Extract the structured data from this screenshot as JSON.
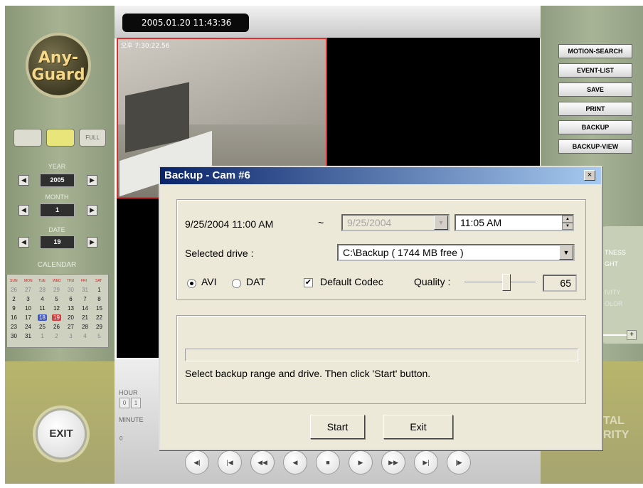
{
  "datetime": "2005.01.20  11:43:36",
  "cam1_osd": "오후 7:30:22.56",
  "logo": {
    "line1": "Any-",
    "line2": "Guard"
  },
  "view_buttons": {
    "full": "FULL"
  },
  "year": {
    "label": "YEAR",
    "value": "2005"
  },
  "month": {
    "label": "MONTH",
    "value": "1"
  },
  "date": {
    "label": "DATE",
    "value": "19"
  },
  "calendar": {
    "title": "CALENDAR",
    "days_of_week": [
      "SUN",
      "MON",
      "TUE",
      "WED",
      "THU",
      "FRI",
      "SAT"
    ],
    "weeks": [
      [
        "26",
        "27",
        "28",
        "29",
        "30",
        "31",
        "1"
      ],
      [
        "2",
        "3",
        "4",
        "5",
        "6",
        "7",
        "8"
      ],
      [
        "9",
        "10",
        "11",
        "12",
        "13",
        "14",
        "15"
      ],
      [
        "16",
        "17",
        "18",
        "19",
        "20",
        "21",
        "22"
      ],
      [
        "23",
        "24",
        "25",
        "26",
        "27",
        "28",
        "29"
      ],
      [
        "30",
        "31",
        "1",
        "2",
        "3",
        "4",
        "5"
      ]
    ]
  },
  "exit_label": "EXIT",
  "right_buttons": [
    "MOTION-SEARCH",
    "EVENT-LIST",
    "SAVE",
    "PRINT",
    "BACKUP",
    "BACKUP-VIEW"
  ],
  "right_panel": {
    "l1": "TNESS",
    "l2": "GHT",
    "l3": "IVITY",
    "l4": "OLOR",
    "brand1": "TAL",
    "brand2": "RITY"
  },
  "bottom": {
    "hour": "HOUR",
    "hour_vals": [
      "0",
      "1"
    ],
    "minute": "MINUTE",
    "minute_val": "0"
  },
  "dialog": {
    "title": "Backup - Cam #6",
    "close": "×",
    "start_datetime": "9/25/2004  11:00 AM",
    "tilde": "~",
    "end_date": "9/25/2004",
    "end_time": "11:05 AM",
    "drive_label": "Selected drive :",
    "drive_value": "C:\\Backup    ( 1744 MB free )",
    "format_avi": "AVI",
    "format_dat": "DAT",
    "default_codec": "Default Codec",
    "quality_label": "Quality :",
    "quality_value": "65",
    "status": "Select backup range and drive. Then click 'Start' button.",
    "start_btn": "Start",
    "exit_btn": "Exit"
  }
}
